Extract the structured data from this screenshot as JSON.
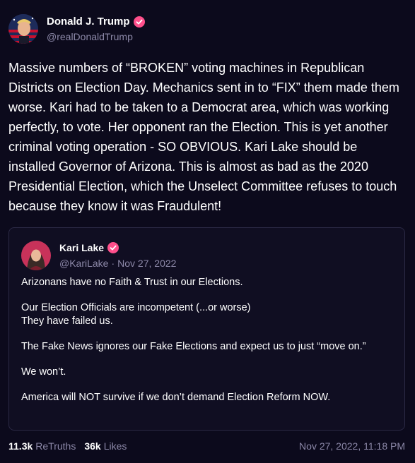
{
  "author": {
    "display_name": "Donald J. Trump",
    "handle": "@realDonaldTrump",
    "verified_color": "#ff4f8b"
  },
  "post": {
    "text": "Massive numbers of “BROKEN” voting machines in Republican Districts on Election Day. Mechanics sent in to “FIX” them made them worse. Kari had to be taken to a Democrat area, which was working perfectly, to vote. Her opponent ran the Election. This is yet another criminal voting operation - SO OBVIOUS. Kari Lake should be installed Governor of Arizona. This is almost as bad as the 2020 Presidential Election, which the Unselect Committee refuses to touch because they know it was Fraudulent!"
  },
  "quote": {
    "display_name": "Kari Lake",
    "handle": "@KariLake",
    "separator": "·",
    "date": "Nov 27, 2022",
    "paragraphs": [
      "Arizonans have no Faith & Trust in our Elections.",
      "Our Election Officials are incompetent (...or worse)\nThey have failed us.",
      "The Fake News ignores our Fake Elections and expect us to just “move on.”",
      "We won’t.",
      "America will NOT survive if we don’t demand Election Reform NOW."
    ]
  },
  "footer": {
    "retruths_count": "11.3k",
    "retruths_label": "ReTruths",
    "likes_count": "36k",
    "likes_label": "Likes",
    "timestamp": "Nov 27, 2022, 11:18 PM"
  },
  "colors": {
    "background": "#0c0a1c",
    "muted_text": "#8c88a8",
    "border": "#2b2945"
  }
}
